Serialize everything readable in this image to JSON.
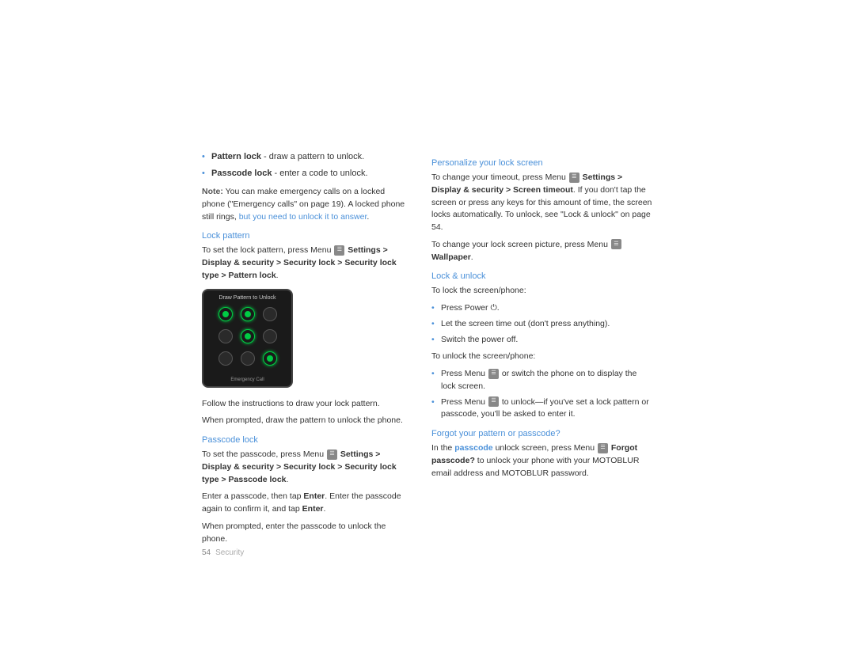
{
  "page": {
    "background": "#ffffff",
    "page_number": "54",
    "footer_label": "Security"
  },
  "left_col": {
    "bullets": [
      {
        "bold": "Pattern lock",
        "rest": " - draw a pattern to unlock."
      },
      {
        "bold": "Passcode lock",
        "rest": " - enter a code to unlock."
      }
    ],
    "note": {
      "label": "Note:",
      "text": " You can make emergency calls on a locked phone (\"Emergency calls\" on page 19). A locked phone still rings, ",
      "link": "but you need to unlock it to answer",
      "text2": "."
    },
    "lock_pattern": {
      "heading": "Lock pattern",
      "body1": "To set the lock pattern, press Menu ",
      "menu_icon": "☰",
      "body2": " > Settings > Display & security > Security lock > Security lock type > Pattern lock.",
      "body3": "Follow the instructions to draw your lock pattern.",
      "body4": "When prompted, draw the pattern to unlock the phone."
    },
    "passcode_lock": {
      "heading": "Passcode lock",
      "body1": "To set the passcode, press Menu ",
      "menu_icon": "☰",
      "body2": " > Settings > Display & security > Security lock > Security lock type > Passcode lock.",
      "body3_pre": "Enter a passcode, then tap ",
      "enter": "Enter",
      "body3_mid": ". Enter the passcode again to confirm it, and tap ",
      "enter2": "Enter",
      "body3_end": ".",
      "body4": "When prompted, enter the passcode to unlock the phone."
    }
  },
  "right_col": {
    "personalize": {
      "heading": "Personalize your lock screen",
      "body1_pre": "To change your timeout, press Menu ",
      "menu_icon": "☰",
      "body1_mid": " > Settings > Display & security > Screen timeout",
      "body1_rest": ". If you don't tap the screen or press any keys for this amount of time, the screen locks automatically. To unlock, see \"Lock & unlock\" on page 54.",
      "body2_pre": "To change your lock screen picture, press Menu ",
      "menu_icon2": "☰",
      "body2_rest": " > Wallpaper."
    },
    "lock_unlock": {
      "heading": "Lock & unlock",
      "intro": "To lock the screen/phone:",
      "bullets": [
        {
          "pre": "Press Power ",
          "icon": "⏻",
          "rest": "."
        },
        {
          "text": "Let the screen time out (don't press anything)."
        },
        {
          "text": "Switch the power off."
        }
      ],
      "intro2": "To unlock the screen/phone:",
      "bullets2": [
        {
          "pre": "Press Menu ",
          "icon": "☰",
          "rest": " or switch the phone on to display the lock screen."
        },
        {
          "pre": "Press Menu ",
          "icon2": "☰",
          "rest": " to unlock—if you've set a lock pattern or passcode, you'll be asked to enter it."
        }
      ]
    },
    "forgot": {
      "heading": "Forgot your pattern or passcode?",
      "body1_pre": "In the ",
      "passcode": "passcode",
      "body1_mid": " unlock screen, press Menu ",
      "icon": "☰",
      "body1_rest": " > Forgot passcode? to unlock your phone with your MOTOBLUR email address and MOTOBLUR password."
    }
  },
  "phone_screen": {
    "header": "Draw Pattern to Unlock",
    "footer": "Emergency Call",
    "pattern": [
      {
        "row": 0,
        "col": 0,
        "active": true
      },
      {
        "row": 0,
        "col": 1,
        "active": true
      },
      {
        "row": 0,
        "col": 2,
        "active": false
      },
      {
        "row": 1,
        "col": 0,
        "active": false
      },
      {
        "row": 1,
        "col": 1,
        "active": true
      },
      {
        "row": 1,
        "col": 2,
        "active": false
      },
      {
        "row": 2,
        "col": 0,
        "active": false
      },
      {
        "row": 2,
        "col": 1,
        "active": false
      },
      {
        "row": 2,
        "col": 2,
        "active": true
      }
    ]
  }
}
